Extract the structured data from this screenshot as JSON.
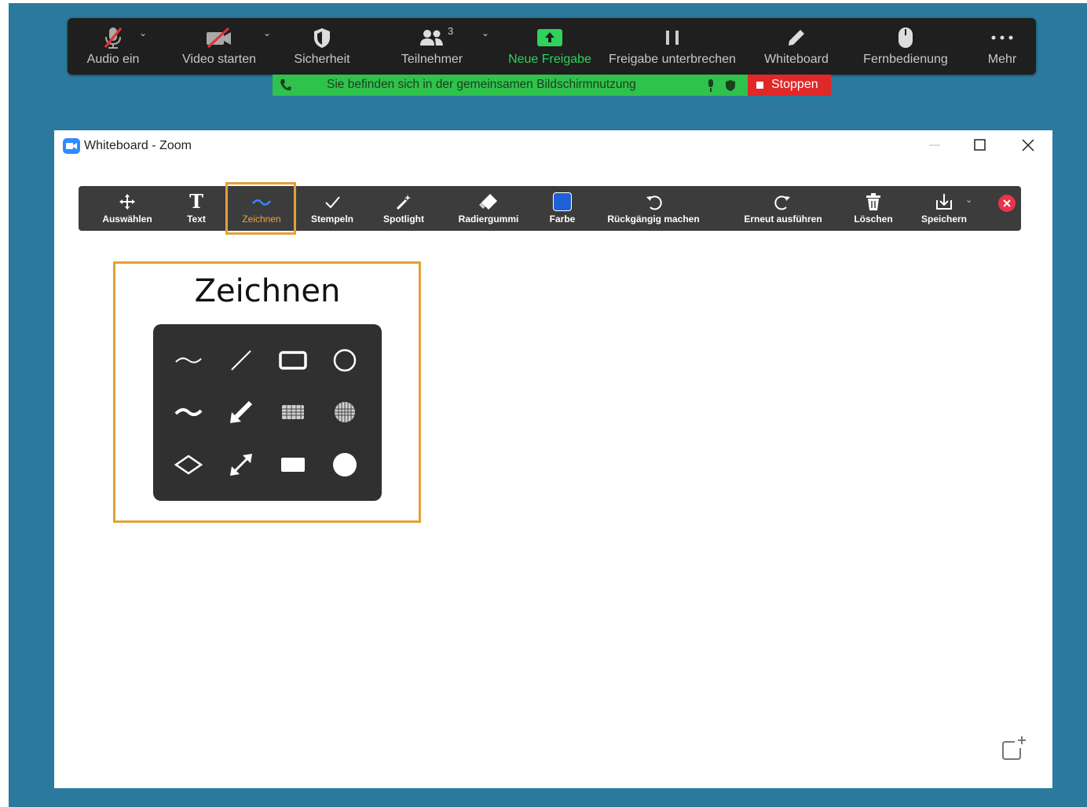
{
  "meeting_toolbar": {
    "items": [
      {
        "label": "Audio ein",
        "icon": "muted-microphone-icon"
      },
      {
        "label": "Video starten",
        "icon": "video-off-icon"
      },
      {
        "label": "Sicherheit",
        "icon": "shield-icon"
      },
      {
        "label": "Teilnehmer",
        "icon": "participants-icon",
        "count": "3"
      },
      {
        "label": "Neue Freigabe",
        "icon": "share-screen-icon"
      },
      {
        "label": "Freigabe unterbrechen",
        "icon": "pause-icon"
      },
      {
        "label": "Whiteboard",
        "icon": "pencil-icon"
      },
      {
        "label": "Fernbedienung",
        "icon": "mouse-icon"
      },
      {
        "label": "Mehr",
        "icon": "more-dots-icon"
      }
    ],
    "share_label_color": "#2fd35a"
  },
  "share_banner": {
    "text": "Sie befinden sich in der gemeinsamen Bildschirmnutzung",
    "stop_label": "Stoppen",
    "color": "#2fc24d"
  },
  "window": {
    "title": "Whiteboard - Zoom"
  },
  "whiteboard_toolbar": {
    "items": [
      {
        "label": "Auswählen",
        "icon": "move-arrows-icon"
      },
      {
        "label": "Text",
        "icon": "text-t-icon"
      },
      {
        "label": "Zeichnen",
        "icon": "squiggle-icon",
        "active": true
      },
      {
        "label": "Stempeln",
        "icon": "checkmark-icon"
      },
      {
        "label": "Spotlight",
        "icon": "magic-wand-icon"
      },
      {
        "label": "Radiergummi",
        "icon": "eraser-icon"
      },
      {
        "label": "Farbe",
        "icon": "color-swatch-icon"
      },
      {
        "label": "Rückgängig machen",
        "icon": "undo-icon"
      },
      {
        "label": "Erneut ausführen",
        "icon": "redo-icon"
      },
      {
        "label": "Löschen",
        "icon": "trash-icon"
      },
      {
        "label": "Speichern",
        "icon": "save-download-icon"
      }
    ],
    "active_color": "#f0a63a",
    "swatch_color": "#1f5fd8"
  },
  "callout": {
    "title": "Zeichnen",
    "highlight_color": "#e3a039"
  },
  "draw_palette": [
    "thin-squiggle-icon",
    "thin-line-icon",
    "thin-rectangle-icon",
    "thin-ellipse-icon",
    "thick-squiggle-icon",
    "thick-arrow-line-icon",
    "translucent-rectangle-icon",
    "translucent-ellipse-icon",
    "diamond-icon",
    "double-arrow-icon",
    "filled-rectangle-icon",
    "filled-ellipse-icon"
  ]
}
